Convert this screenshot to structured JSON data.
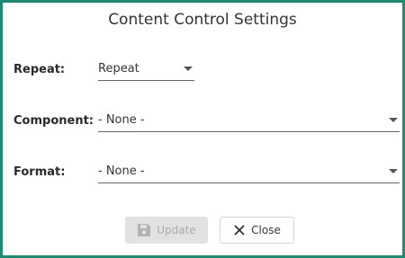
{
  "dialog": {
    "title": "Content Control Settings"
  },
  "fields": {
    "repeat": {
      "label": "Repeat:",
      "value": "Repeat"
    },
    "component": {
      "label": "Component:",
      "value": "- None -"
    },
    "format": {
      "label": "Format:",
      "value": "- None -"
    }
  },
  "buttons": {
    "update_label": "Update",
    "close_label": "Close"
  },
  "icons": {
    "update": "save-icon",
    "close": "close-icon"
  },
  "colors": {
    "border": "#1e8a72",
    "disabled_button": "#e2e2e2",
    "disabled_text": "#a9a9a9"
  }
}
